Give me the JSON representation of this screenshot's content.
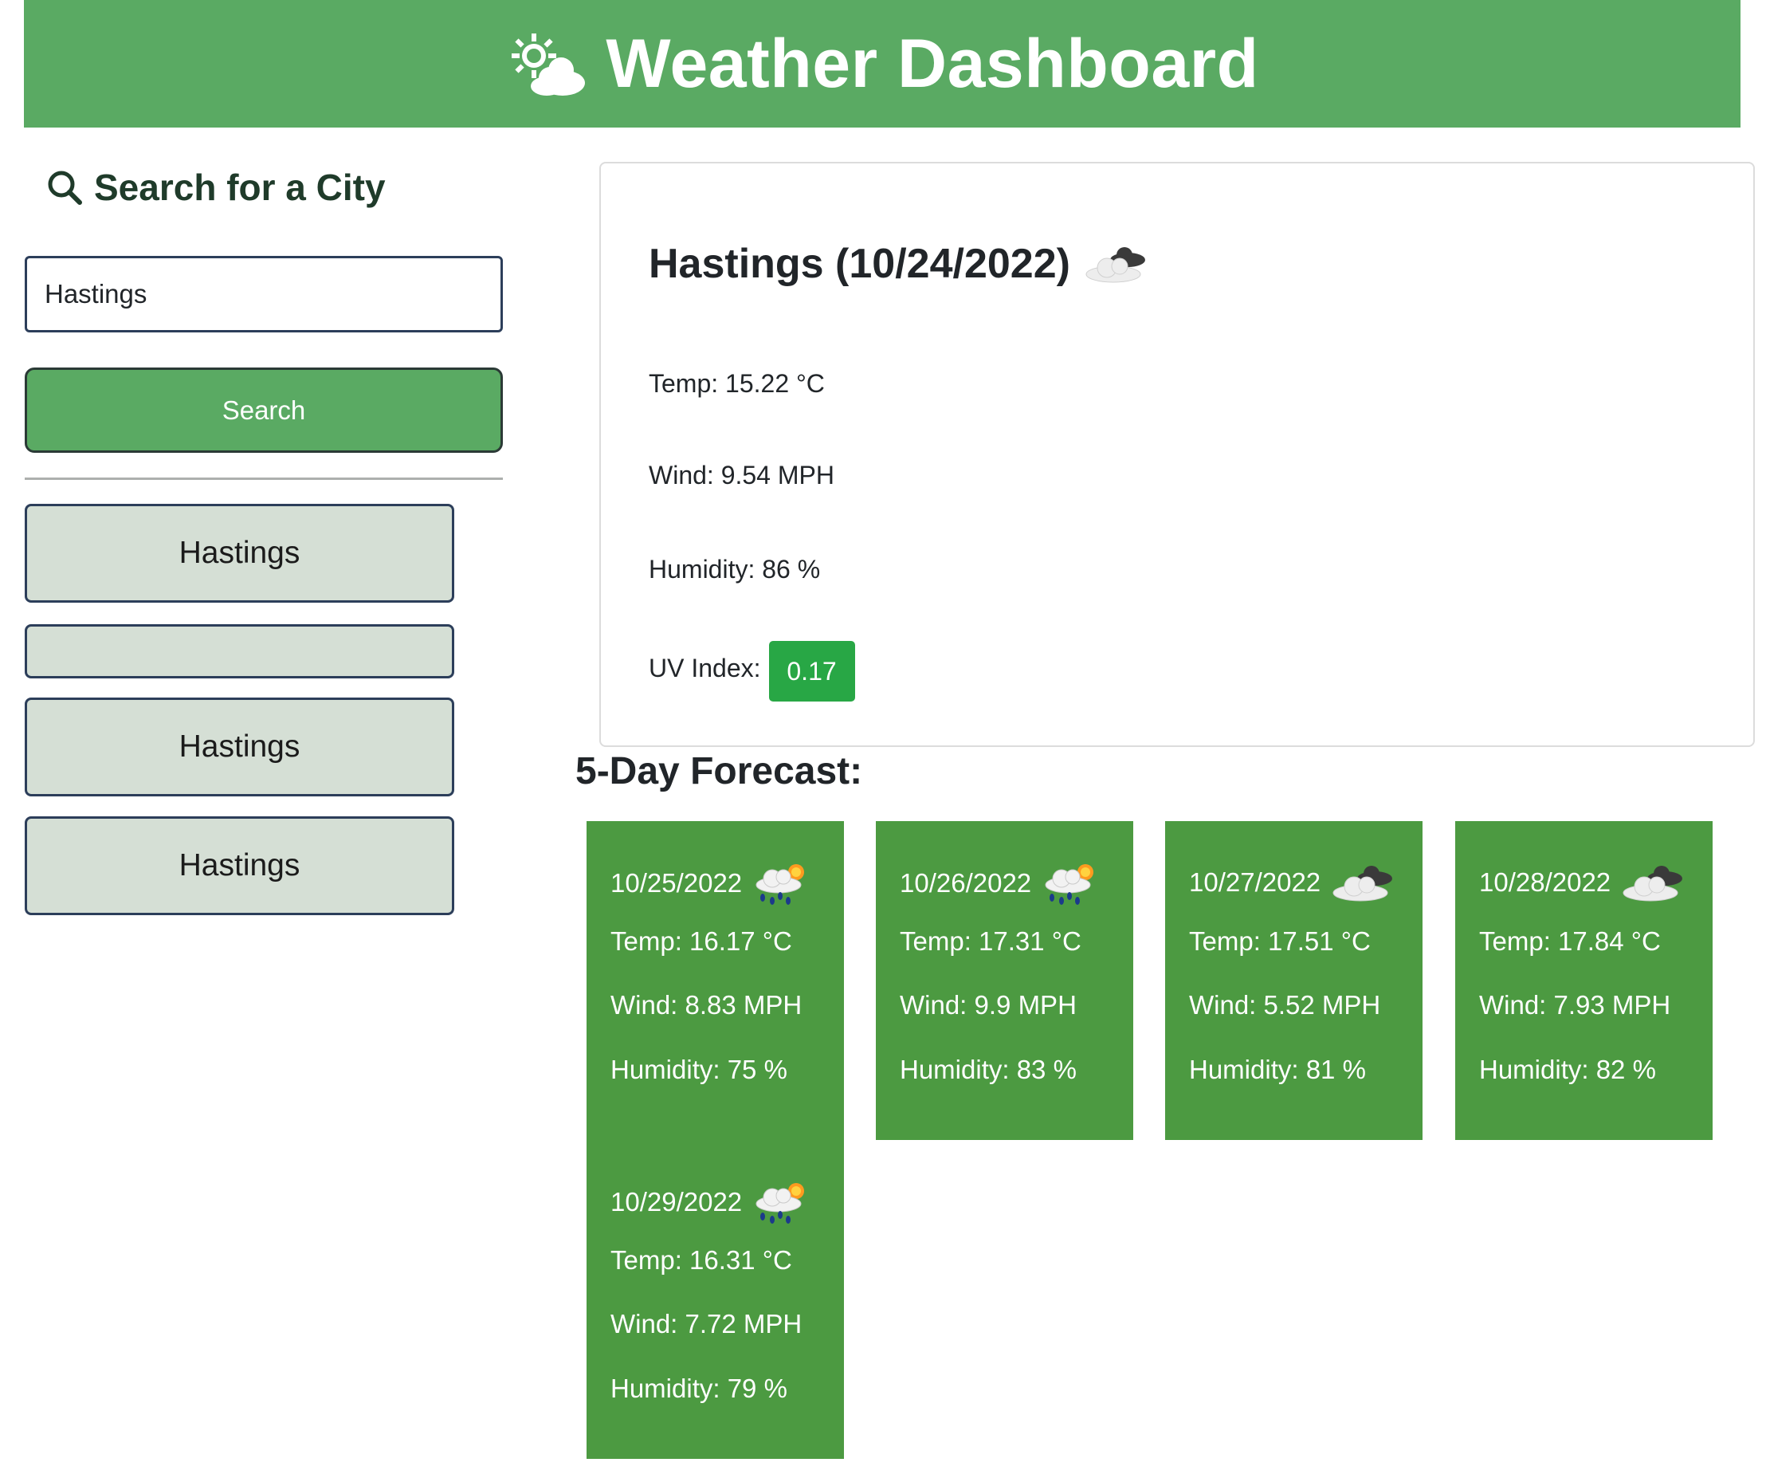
{
  "header": {
    "title": "Weather Dashboard",
    "icon": "sun-cloud-icon"
  },
  "colors": {
    "primary": "#5aaa63",
    "forecast_card": "#4c9a41",
    "history_btn": "#d5dfd5",
    "uv_badge": "#28a745"
  },
  "search": {
    "heading": "Search for a City",
    "input_value": "Hastings",
    "button_label": "Search"
  },
  "history": [
    {
      "label": "Hastings"
    },
    {
      "label": ""
    },
    {
      "label": "Hastings"
    },
    {
      "label": "Hastings"
    }
  ],
  "current": {
    "title": "Hastings (10/24/2022)",
    "icon": "cloudy-icon",
    "temp": "Temp: 15.22 °C",
    "wind": "Wind: 9.54 MPH",
    "humidity": "Humidity: 86 %",
    "uv_label": "UV Index:",
    "uv_value": "0.17"
  },
  "forecast": {
    "heading": "5-Day Forecast:",
    "days": [
      {
        "date": "10/25/2022",
        "icon": "rain-sun-icon",
        "temp": "Temp: 16.17 °C",
        "wind": "Wind: 8.83 MPH",
        "humidity": "Humidity: 75 %"
      },
      {
        "date": "10/26/2022",
        "icon": "rain-sun-icon",
        "temp": "Temp: 17.31 °C",
        "wind": "Wind: 9.9 MPH",
        "humidity": "Humidity: 83 %"
      },
      {
        "date": "10/27/2022",
        "icon": "cloudy-icon",
        "temp": "Temp: 17.51 °C",
        "wind": "Wind: 5.52 MPH",
        "humidity": "Humidity: 81 %"
      },
      {
        "date": "10/28/2022",
        "icon": "cloudy-icon",
        "temp": "Temp: 17.84 °C",
        "wind": "Wind: 7.93 MPH",
        "humidity": "Humidity: 82 %"
      },
      {
        "date": "10/29/2022",
        "icon": "rain-sun-icon",
        "temp": "Temp: 16.31 °C",
        "wind": "Wind: 7.72 MPH",
        "humidity": "Humidity: 79 %"
      }
    ]
  }
}
